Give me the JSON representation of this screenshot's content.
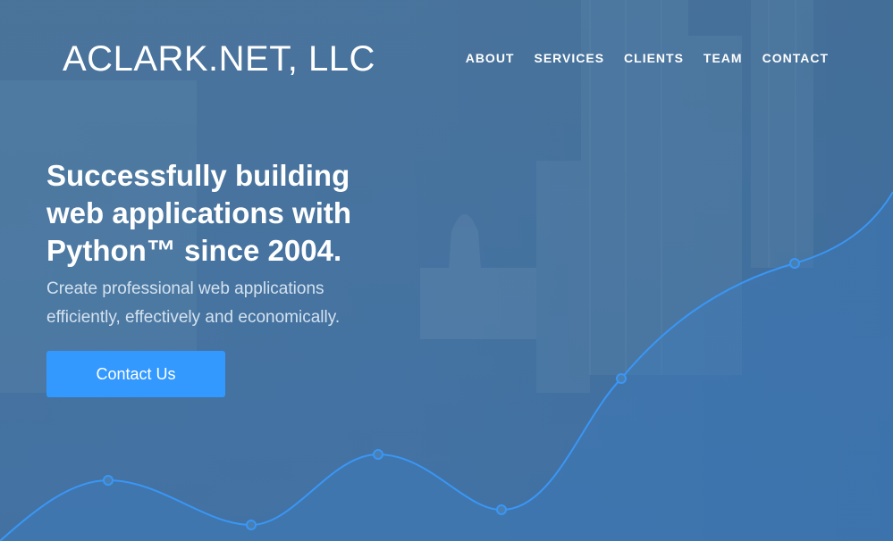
{
  "brand": {
    "logo_text": "ACLARK.NET, LLC"
  },
  "nav": [
    {
      "label": "ABOUT"
    },
    {
      "label": "SERVICES"
    },
    {
      "label": "CLIENTS"
    },
    {
      "label": "TEAM"
    },
    {
      "label": "CONTACT"
    }
  ],
  "hero": {
    "headline_lines": [
      "Successfully building",
      "web applications with",
      "Python™ since 2004."
    ],
    "sub_lines": [
      "Create professional web applications",
      "efficiently, effectively and economically."
    ],
    "cta_label": "Contact Us"
  },
  "colors": {
    "accent": "#3399ff",
    "line": "#3a96f5",
    "background": "#4a7398"
  }
}
